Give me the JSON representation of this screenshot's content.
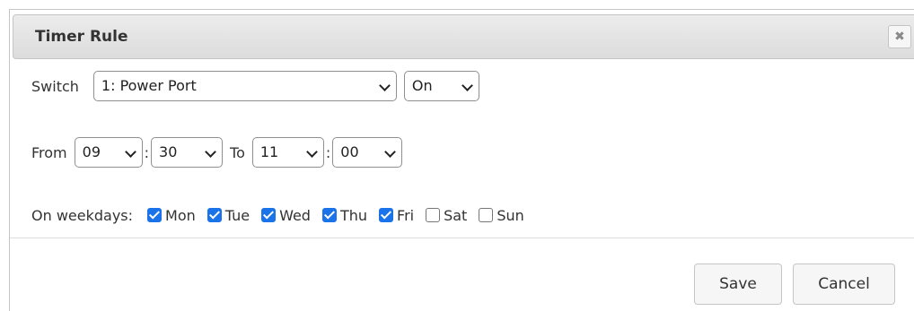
{
  "dialog": {
    "title": "Timer Rule",
    "close_glyph": "✖"
  },
  "switch": {
    "label": "Switch",
    "selected_port": "1: Power Port",
    "selected_state": "On"
  },
  "time": {
    "from_label": "From",
    "from_hour": "09",
    "from_minute": "30",
    "to_label": "To",
    "to_hour": "11",
    "to_minute": "00",
    "separator": ":"
  },
  "weekdays": {
    "label": "On weekdays:",
    "days": [
      {
        "label": "Mon",
        "checked": true
      },
      {
        "label": "Tue",
        "checked": true
      },
      {
        "label": "Wed",
        "checked": true
      },
      {
        "label": "Thu",
        "checked": true
      },
      {
        "label": "Fri",
        "checked": true
      },
      {
        "label": "Sat",
        "checked": false
      },
      {
        "label": "Sun",
        "checked": false
      }
    ]
  },
  "buttons": {
    "save_label": "Save",
    "cancel_label": "Cancel"
  },
  "colors": {
    "checkbox_checked": "#1a73e8",
    "titlebar_bg": "#e3e3e3"
  }
}
